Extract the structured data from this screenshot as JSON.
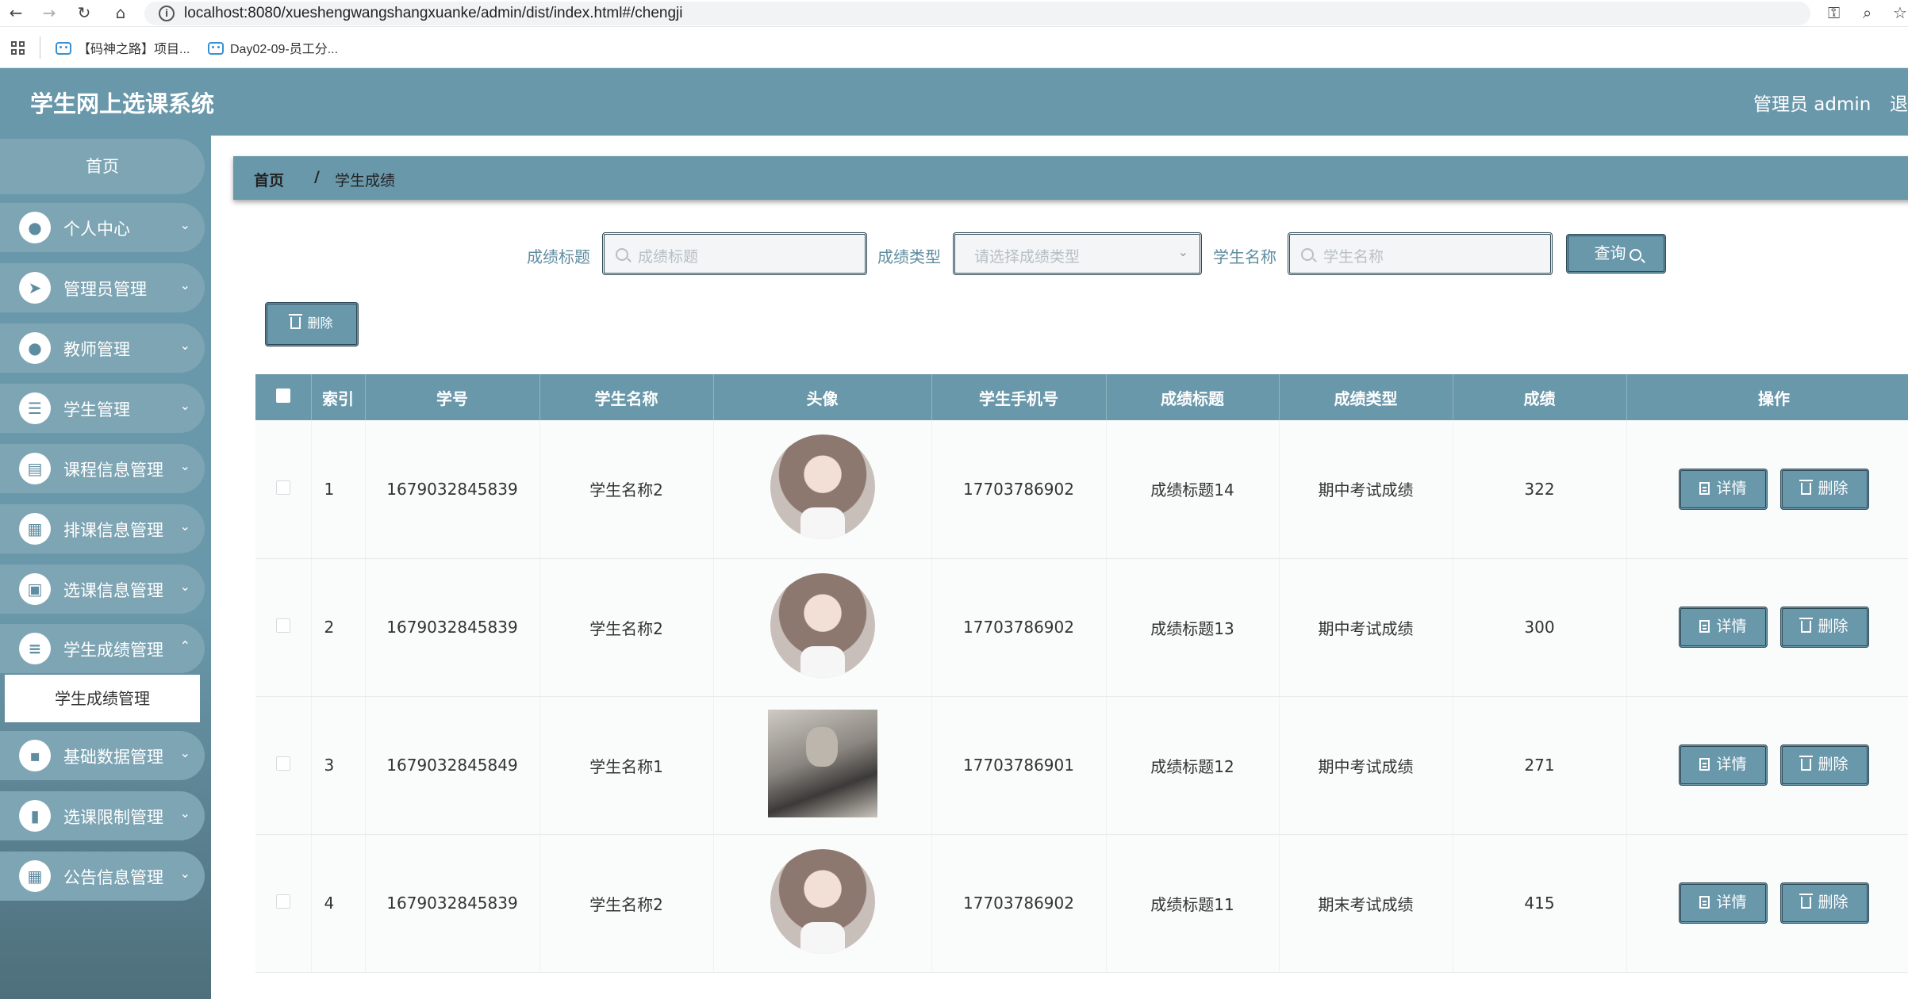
{
  "browser": {
    "url": "localhost:8080/xueshengwangshangxuanke/admin/dist/index.html#/chengji",
    "bookmarks": [
      "【码神之路】项目...",
      "Day02-09-员工分..."
    ]
  },
  "header": {
    "title": "学生网上选课系统",
    "admin_label": "管理员 admin",
    "logout_label": "退出登录"
  },
  "sidebar": {
    "home": "首页",
    "items": [
      {
        "label": "个人中心",
        "icon": "user-icon"
      },
      {
        "label": "管理员管理",
        "icon": "paper-plane-icon"
      },
      {
        "label": "教师管理",
        "icon": "user-icon"
      },
      {
        "label": "学生管理",
        "icon": "list-icon"
      },
      {
        "label": "课程信息管理",
        "icon": "briefcase-icon"
      },
      {
        "label": "排课信息管理",
        "icon": "grid-icon"
      },
      {
        "label": "选课信息管理",
        "icon": "clipboard-icon"
      },
      {
        "label": "学生成绩管理",
        "icon": "sliders-icon"
      },
      {
        "label": "基础数据管理",
        "icon": "chat-icon"
      },
      {
        "label": "选课限制管理",
        "icon": "book-icon"
      },
      {
        "label": "公告信息管理",
        "icon": "grid-icon"
      }
    ],
    "active_sub": "学生成绩管理"
  },
  "breadcrumb": {
    "home": "首页",
    "separator": "/",
    "current": "学生成绩"
  },
  "search": {
    "title_label": "成绩标题",
    "title_placeholder": "成绩标题",
    "type_label": "成绩类型",
    "type_placeholder": "请选择成绩类型",
    "name_label": "学生名称",
    "name_placeholder": "学生名称",
    "query_label": "查询"
  },
  "toolbar": {
    "delete_label": "删除"
  },
  "table": {
    "headers": [
      "索引",
      "学号",
      "学生名称",
      "头像",
      "学生手机号",
      "成绩标题",
      "成绩类型",
      "成绩",
      "操作"
    ],
    "detail_label": "详情",
    "delete_label": "删除",
    "rows": [
      {
        "index": "1",
        "student_no": "1679032845839",
        "name": "学生名称2",
        "avatar": "girl",
        "phone": "17703786902",
        "title": "成绩标题14",
        "type": "期中考试成绩",
        "score": "322"
      },
      {
        "index": "2",
        "student_no": "1679032845839",
        "name": "学生名称2",
        "avatar": "girl",
        "phone": "17703786902",
        "title": "成绩标题13",
        "type": "期中考试成绩",
        "score": "300"
      },
      {
        "index": "3",
        "student_no": "1679032845849",
        "name": "学生名称1",
        "avatar": "boy",
        "phone": "17703786901",
        "title": "成绩标题12",
        "type": "期中考试成绩",
        "score": "271"
      },
      {
        "index": "4",
        "student_no": "1679032845839",
        "name": "学生名称2",
        "avatar": "girl",
        "phone": "17703786902",
        "title": "成绩标题11",
        "type": "期末考试成绩",
        "score": "415"
      }
    ]
  },
  "colors": {
    "primary": "#6a98ab",
    "border": "#2e4a57",
    "sidebar_item": "#7ea5b4"
  }
}
